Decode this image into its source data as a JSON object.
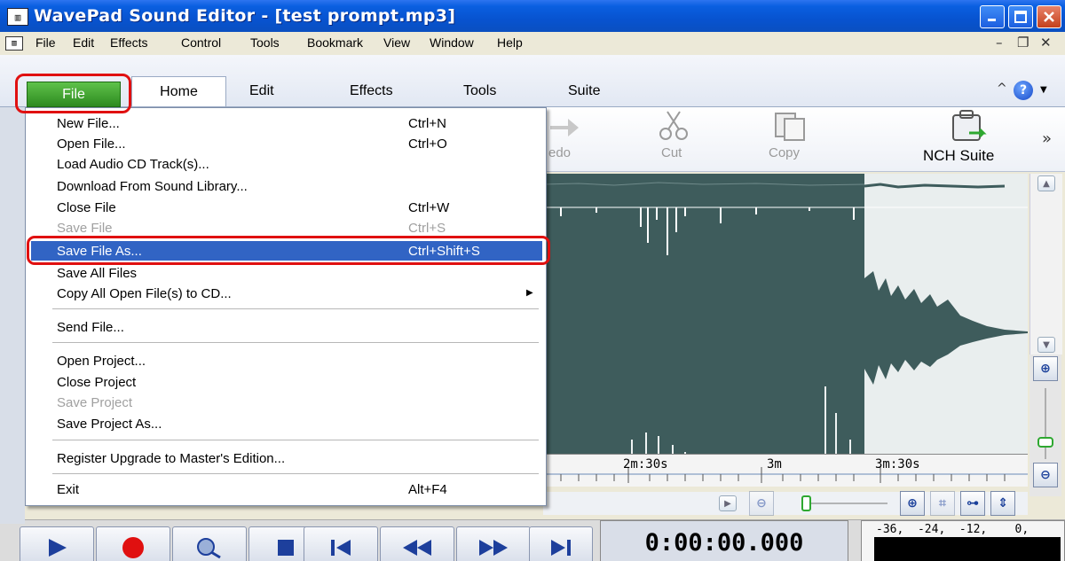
{
  "window": {
    "title": "WavePad Sound Editor - [test prompt.mp3]"
  },
  "menubar": {
    "items": [
      "File",
      "Edit",
      "Effects",
      "Control",
      "Tools",
      "Bookmark",
      "View",
      "Window",
      "Help"
    ]
  },
  "ribbon": {
    "tabs": {
      "file": "File",
      "home": "Home",
      "edit": "Edit",
      "effects": "Effects",
      "tools": "Tools",
      "suite": "Suite"
    }
  },
  "toolbar": {
    "redo": "edo",
    "cut": "Cut",
    "copy": "Copy",
    "nch_suite": "NCH Suite"
  },
  "file_menu": {
    "items": [
      {
        "label": "New File...",
        "shortcut": "Ctrl+N"
      },
      {
        "label": "Open File...",
        "shortcut": "Ctrl+O"
      },
      {
        "label": "Load Audio CD Track(s)...",
        "shortcut": ""
      },
      {
        "label": "Download From Sound Library...",
        "shortcut": ""
      },
      {
        "label": "Close File",
        "shortcut": "Ctrl+W"
      },
      {
        "label": "Save File",
        "shortcut": "Ctrl+S"
      },
      {
        "label": "Save File As...",
        "shortcut": "Ctrl+Shift+S"
      },
      {
        "label": "Save All Files",
        "shortcut": ""
      },
      {
        "label": "Copy All Open File(s) to CD...",
        "shortcut": ""
      },
      {
        "label": "Send File...",
        "shortcut": ""
      },
      {
        "label": "Open Project...",
        "shortcut": ""
      },
      {
        "label": "Close Project",
        "shortcut": ""
      },
      {
        "label": "Save Project",
        "shortcut": ""
      },
      {
        "label": "Save Project As...",
        "shortcut": ""
      },
      {
        "label": "Register Upgrade to Master's Edition...",
        "shortcut": ""
      },
      {
        "label": "Exit",
        "shortcut": "Alt+F4"
      }
    ]
  },
  "timeline": {
    "labels": [
      "2m:30s",
      "3m",
      "3m:30s"
    ]
  },
  "transport": {
    "time": "0:00:00.000"
  },
  "meter": {
    "scale": "-36,  -24,  -12,    0,"
  },
  "colors": {
    "waveform": "#3e5c5c",
    "highlight": "#3164c4",
    "annotation": "#e01010",
    "file_tab": "#3ea42e"
  }
}
